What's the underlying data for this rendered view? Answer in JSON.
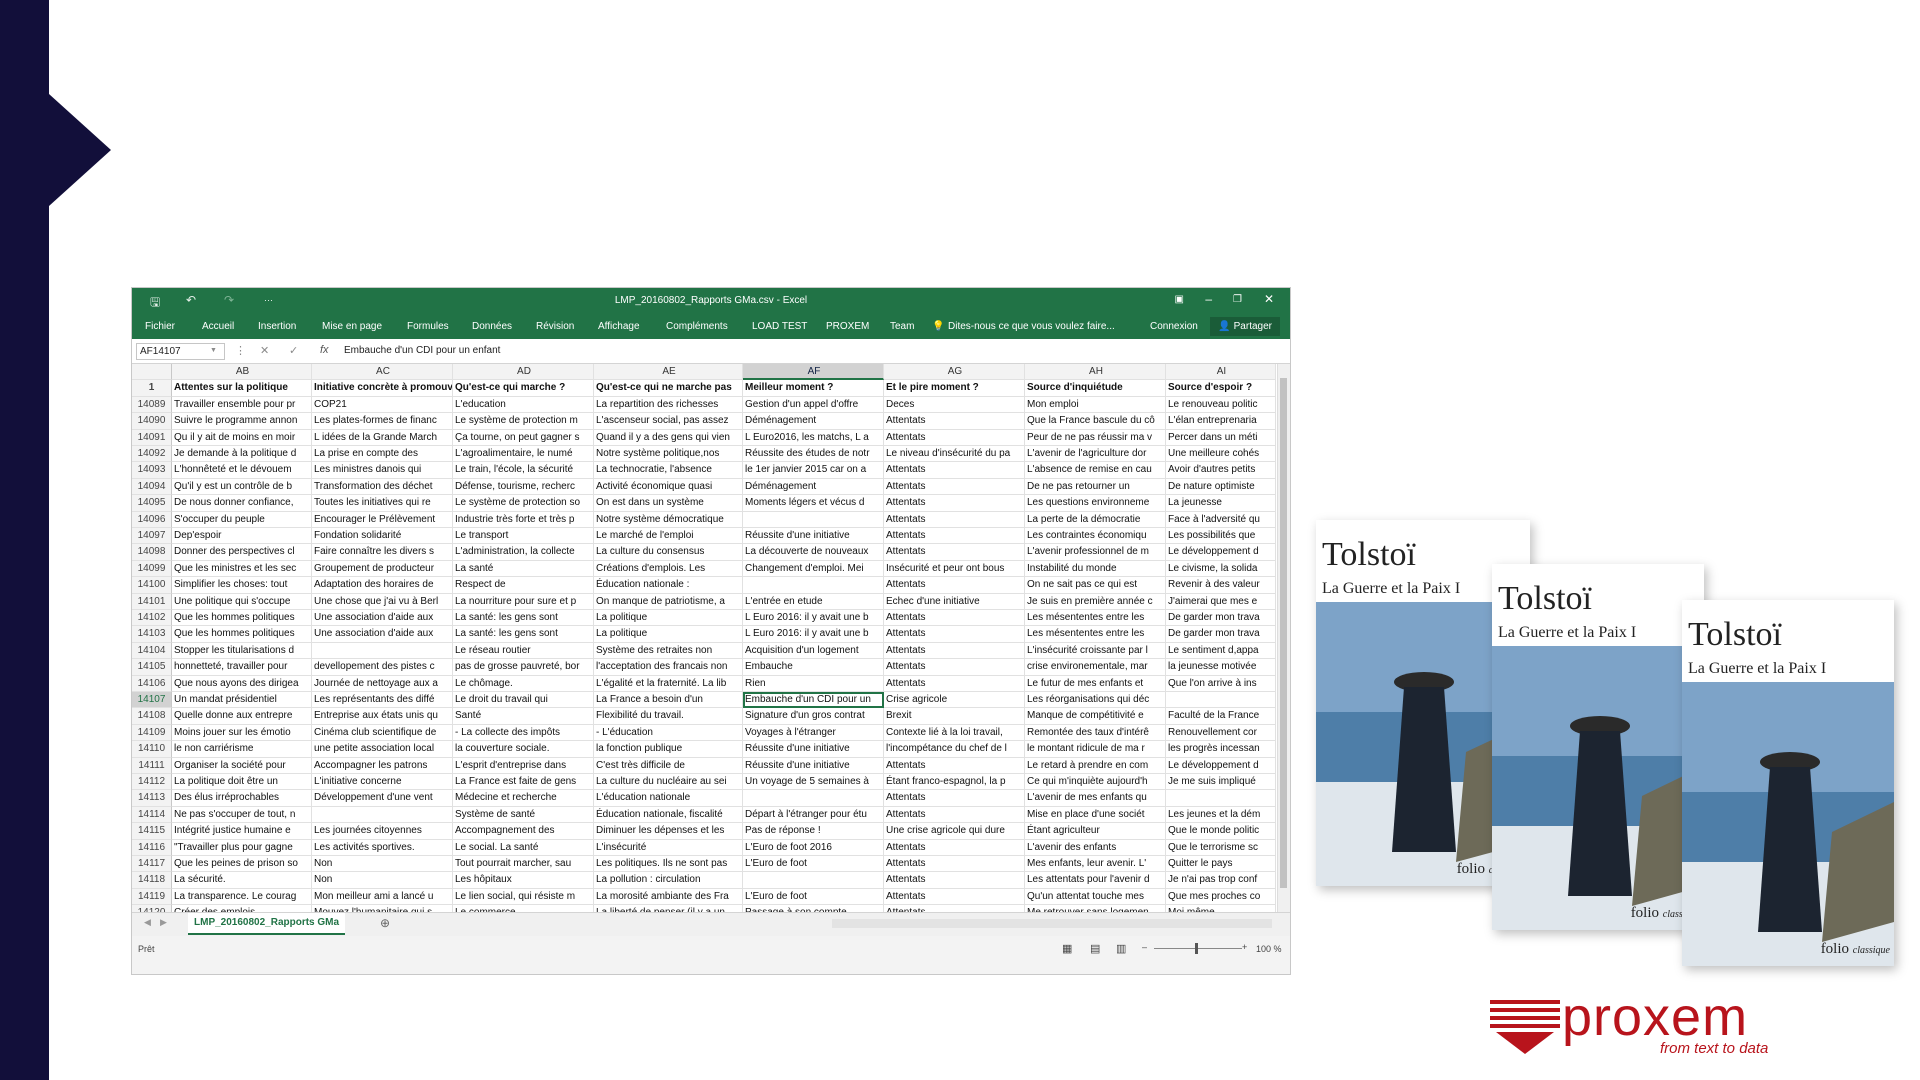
{
  "excel": {
    "title": "LMP_20160802_Rapports GMa.csv - Excel",
    "ribbon_tabs": [
      "Fichier",
      "Accueil",
      "Insertion",
      "Mise en page",
      "Formules",
      "Données",
      "Révision",
      "Affichage",
      "Compléments",
      "LOAD TEST",
      "PROXEM",
      "Team"
    ],
    "tell_me": "Dites-nous ce que vous voulez faire...",
    "connexion": "Connexion",
    "share": "Partager",
    "name_box": "AF14107",
    "formula": "Embauche d'un CDI pour un enfant",
    "columns": [
      "AB",
      "AC",
      "AD",
      "AE",
      "AF",
      "AG",
      "AH",
      "AI"
    ],
    "selected_column": "AF",
    "header_row": {
      "num": "1",
      "cells": [
        "Attentes sur la politique",
        "Initiative concrète à promouvoir",
        "Qu'est-ce qui marche ?",
        "Qu'est-ce qui ne marche pas",
        "Meilleur moment ?",
        "Et le pire moment ?",
        "Source d'inquiétude",
        "Source d'espoir ?"
      ]
    },
    "rows": [
      {
        "num": "14089",
        "cells": [
          "Travailler ensemble pour pr",
          "COP21",
          "L'education",
          "La repartition des richesses",
          "Gestion d'un appel d'offre",
          "Deces",
          "Mon emploi",
          "Le renouveau politic"
        ]
      },
      {
        "num": "14090",
        "cells": [
          "Suivre le programme annon",
          "Les plates-formes de financ",
          "Le système de protection m",
          "L'ascenseur social, pas assez",
          "Déménagement",
          "Attentats",
          "Que la France bascule du cô",
          "L'élan entreprenaria"
        ]
      },
      {
        "num": "14091",
        "cells": [
          "Qu il y ait de moins en moir",
          "L idées de la Grande March",
          "Ça tourne, on peut gagner s",
          "Quand il y a des gens qui vien",
          "L Euro2016, les matchs, L a",
          "Attentats",
          "Peur de ne pas réussir ma v",
          "Percer dans un méti"
        ]
      },
      {
        "num": "14092",
        "cells": [
          "Je demande à la politique d",
          "La prise en compte des",
          "L'agroalimentaire, le numé",
          "Notre système politique,nos",
          "Réussite des études de notr",
          "Le niveau d'insécurité du pa",
          "L'avenir de l'agriculture dor",
          "Une meilleure cohés"
        ]
      },
      {
        "num": "14093",
        "cells": [
          "L'honnêteté et le dévouem",
          "Les ministres danois qui",
          "Le train, l'école, la sécurité",
          "La technocratie, l'absence",
          "le 1er janvier 2015 car on a",
          "Attentats",
          "L'absence de remise en cau",
          "Avoir d'autres petits"
        ]
      },
      {
        "num": "14094",
        "cells": [
          "Qu'il y est un contrôle de b",
          "Transformation des déchet",
          "Défense, tourisme, recherc",
          "Activité économique quasi",
          "Déménagement",
          "Attentats",
          "De ne pas retourner un",
          "De nature optimiste"
        ]
      },
      {
        "num": "14095",
        "cells": [
          "De nous donner confiance,",
          "Toutes les initiatives qui re",
          "Le système de protection so",
          "On est dans un système",
          "Moments légers et vécus d",
          "Attentats",
          "Les questions environneme",
          "La jeunesse"
        ]
      },
      {
        "num": "14096",
        "cells": [
          "S'occuper du peuple",
          "Encourager le Prélèvement",
          "Industrie très forte et très p",
          "Notre système démocratique",
          "",
          "Attentats",
          "La perte de la démocratie",
          "Face à l'adversité qu"
        ]
      },
      {
        "num": "14097",
        "cells": [
          "Dep'espoir",
          "Fondation solidarité",
          "Le transport",
          "Le marché de l'emploi",
          "Réussite d'une initiative",
          "Attentats",
          "Les contraintes économiqu",
          "Les possibilités que"
        ]
      },
      {
        "num": "14098",
        "cells": [
          "Donner des perspectives cl",
          "Faire connaître les divers s",
          "L'administration, la collecte",
          "La culture du consensus",
          "La découverte de nouveaux",
          "Attentats",
          "L'avenir professionnel de m",
          "Le développement d"
        ]
      },
      {
        "num": "14099",
        "cells": [
          "Que les ministres et les sec",
          "Groupement de producteur",
          "La santé",
          "Créations d'emplois. Les",
          "Changement d'emploi. Mei",
          "Insécurité et peur ont bous",
          "Instabilité du monde",
          "Le civisme, la solida"
        ]
      },
      {
        "num": "14100",
        "cells": [
          "Simplifier les choses: tout",
          "Adaptation des horaires de",
          "Respect de",
          "Éducation nationale :",
          "",
          "Attentats",
          "On ne sait pas ce qui est",
          "Revenir à des valeur"
        ]
      },
      {
        "num": "14101",
        "cells": [
          "Une politique qui s'occupe",
          "Une chose que j'ai vu à Berl",
          "La nourriture pour sure et p",
          "On manque de patriotisme, a",
          "L'entrée en etude",
          "Echec d'une initiative",
          "Je suis en première année c",
          "J'aimerai que mes e"
        ]
      },
      {
        "num": "14102",
        "cells": [
          "Que les hommes politiques",
          "Une association d'aide aux",
          "La santé: les gens sont",
          "La politique",
          "L Euro 2016: il y avait une b",
          "Attentats",
          "Les mésententes entre les",
          "De garder mon trava"
        ]
      },
      {
        "num": "14103",
        "cells": [
          "Que les hommes politiques",
          "Une association d'aide aux",
          "La santé: les gens sont",
          "La politique",
          "L Euro 2016: il y avait une b",
          "Attentats",
          "Les mésententes entre les",
          "De garder mon trava"
        ]
      },
      {
        "num": "14104",
        "cells": [
          "Stopper les titularisations d",
          "",
          "Le réseau routier",
          "Système des retraites non",
          "Acquisition d'un logement",
          "Attentats",
          "L'insécurité croissante par l",
          "Le sentiment d,appa"
        ]
      },
      {
        "num": "14105",
        "cells": [
          "honnetteté, travailler pour",
          "devellopement des pistes c",
          "pas de grosse pauvreté, bor",
          "l'acceptation des francais non",
          "Embauche",
          "Attentats",
          "crise environementale, mar",
          "la jeunesse motivée"
        ]
      },
      {
        "num": "14106",
        "cells": [
          "Que nous ayons des dirigea",
          "Journée de nettoyage aux a",
          "Le chômage.",
          "L'égalité et la fraternité. La lib",
          "Rien",
          "Attentats",
          "Le futur de mes enfants et",
          "Que l'on arrive à ins"
        ]
      },
      {
        "num": "14107",
        "cells": [
          "Un mandat présidentiel",
          "Les représentants des diffé",
          "Le droit du travail qui",
          "La France a besoin d'un",
          "Embauche d'un CDI pour un",
          "Crise agricole",
          "Les réorganisations qui déc",
          ""
        ]
      },
      {
        "num": "14108",
        "cells": [
          "Quelle donne aux entrepre",
          "Entreprise aux états unis qu",
          "Santé",
          "Flexibilité du travail.",
          "Signature d'un gros contrat",
          "Brexit",
          "Manque de compétitivité e",
          "Faculté de la France"
        ]
      },
      {
        "num": "14109",
        "cells": [
          "Moins jouer sur les émotio",
          "Cinéma club scientifique de",
          "- La collecte des impôts",
          "- L'éducation",
          "Voyages à l'étranger",
          "Contexte lié à la loi travail,",
          "Remontée des taux d'intérê",
          "Renouvellement cor"
        ]
      },
      {
        "num": "14110",
        "cells": [
          "le non carriérisme",
          "une petite association local",
          "la couverture sociale.",
          "la fonction publique",
          "Réussite d'une initiative",
          "l'incompétance du chef de l",
          "le montant ridicule de ma r",
          "les progrès incessan"
        ]
      },
      {
        "num": "14111",
        "cells": [
          "Organiser la société pour",
          "Accompagner les patrons",
          "L'esprit d'entreprise dans",
          "C'est très difficile de",
          "Réussite d'une initiative",
          "Attentats",
          "Le retard à prendre en com",
          "Le développement d"
        ]
      },
      {
        "num": "14112",
        "cells": [
          "La politique doit être un",
          "L'initiative concerne",
          "La France est faite de gens",
          "La culture du nucléaire au sei",
          "Un voyage de 5 semaines à",
          "Étant franco-espagnol, la p",
          "Ce qui m'inquiète aujourd'h",
          "Je me suis impliqué"
        ]
      },
      {
        "num": "14113",
        "cells": [
          "Des élus irréprochables",
          "Développement d'une vent",
          "Médecine et recherche",
          "L'éducation nationale",
          "",
          "Attentats",
          "L'avenir de mes enfants qu",
          ""
        ]
      },
      {
        "num": "14114",
        "cells": [
          "Ne pas s'occuper de tout, n",
          "",
          "Système de santé",
          "Éducation nationale, fiscalité",
          "Départ à l'étranger pour étu",
          "Attentats",
          "Mise en place d'une sociét",
          "Les jeunes et la dém"
        ]
      },
      {
        "num": "14115",
        "cells": [
          "Intégrité justice humaine e",
          "Les journées citoyennes",
          "Accompagnement des",
          "Diminuer les dépenses et les",
          "Pas de réponse !",
          "Une crise agricole qui dure",
          "Étant agriculteur",
          "Que le monde politic"
        ]
      },
      {
        "num": "14116",
        "cells": [
          "\"Travailler plus pour gagne",
          "Les activités sportives.",
          "Le social. La santé",
          "L'insécurité",
          "L'Euro de foot 2016",
          "Attentats",
          "L'avenir des enfants",
          "Que le terrorisme sc"
        ]
      },
      {
        "num": "14117",
        "cells": [
          "Que les peines de prison so",
          "Non",
          "Tout pourrait marcher, sau",
          "Les politiques. Ils ne sont pas",
          "L'Euro de foot",
          "Attentats",
          "Mes enfants, leur avenir. L'",
          "Quitter le pays"
        ]
      },
      {
        "num": "14118",
        "cells": [
          "La sécurité.",
          "Non",
          "Les hôpitaux",
          "La pollution : circulation",
          "",
          "Attentats",
          "Les attentats pour l'avenir d",
          "Je n'ai pas trop conf"
        ]
      },
      {
        "num": "14119",
        "cells": [
          "La transparence. Le courag",
          "Mon meilleur ami a lancé u",
          "Le lien social, qui résiste m",
          "La morosité ambiante des Fra",
          "L'Euro de foot",
          "Attentats",
          "Qu'un attentat touche mes",
          "Que mes proches co"
        ]
      },
      {
        "num": "14120",
        "cells": [
          "Créer des emplois",
          "Mouvez l'humanitaire qui s",
          "Le commerce",
          "La liberté de penser (il y a un",
          "Passage à son compte",
          "Attentats",
          "Me retrouver sans logemen",
          "Moi même"
        ]
      }
    ],
    "sheet_tab": "LMP_20160802_Rapports GMa",
    "status": "Prêt",
    "zoom": "100 %"
  },
  "books": [
    {
      "author": "Tolstoï",
      "title": "La Guerre et la Paix I",
      "publisher": "folio",
      "publisher_suffix": "classique"
    },
    {
      "author": "Tolstoï",
      "title": "La Guerre et la Paix I",
      "publisher": "folio",
      "publisher_suffix": "classique"
    },
    {
      "author": "Tolstoï",
      "title": "La Guerre et la Paix I",
      "publisher": "folio",
      "publisher_suffix": "classique"
    }
  ],
  "logo": {
    "name": "proxem",
    "tagline": "from text to data",
    "color": "#b8141c"
  },
  "colors": {
    "sidebar": "#120f3a",
    "excel_green": "#217346"
  }
}
